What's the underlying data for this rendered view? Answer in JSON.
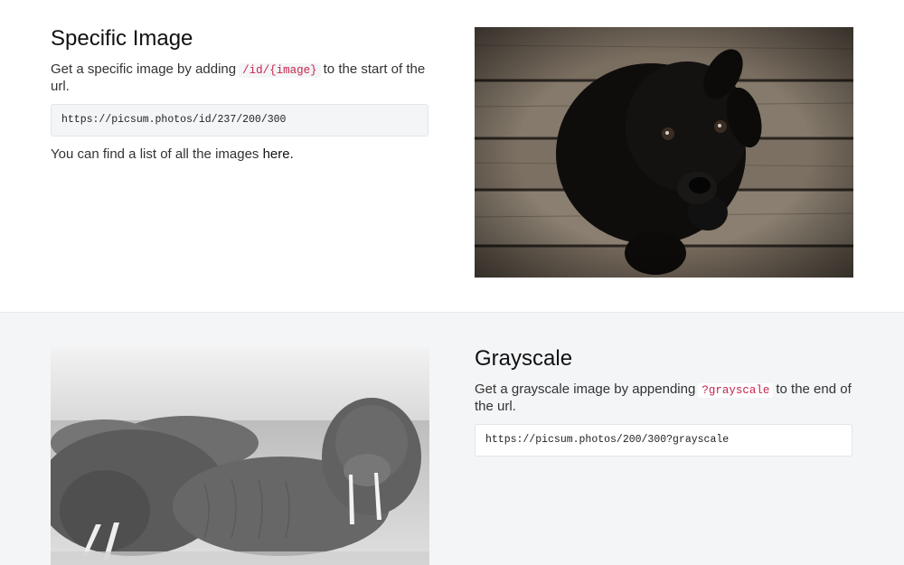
{
  "specific_image": {
    "title": "Specific Image",
    "desc_prefix": "Get a specific image by adding",
    "desc_code": "/id/{image}",
    "desc_suffix": "to the start of the url.",
    "example_url": "https://picsum.photos/id/237/200/300",
    "find_prefix": "You can find a list of all the images",
    "find_link": "here."
  },
  "grayscale": {
    "title": "Grayscale",
    "desc_prefix": "Get a grayscale image by appending",
    "desc_code": "?grayscale",
    "desc_suffix": "to the end of the url.",
    "example_url": "https://picsum.photos/200/300?grayscale"
  },
  "colors": {
    "code_text": "#c7254e",
    "alt_section_bg": "#f4f5f7"
  }
}
